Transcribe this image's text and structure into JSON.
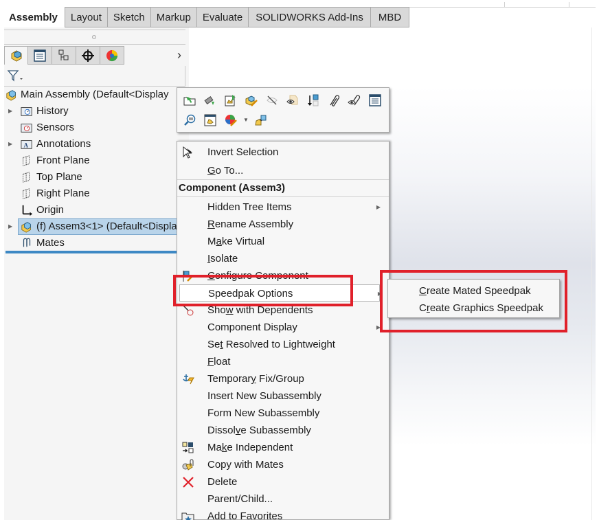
{
  "command_tabs": [
    {
      "label": "Assembly",
      "active": true
    },
    {
      "label": "Layout",
      "active": false
    },
    {
      "label": "Sketch",
      "active": false
    },
    {
      "label": "Markup",
      "active": false
    },
    {
      "label": "Evaluate",
      "active": false
    },
    {
      "label": "SOLIDWORKS Add-Ins",
      "active": false
    },
    {
      "label": "MBD",
      "active": false
    }
  ],
  "panel_tabs": [
    "feature-manager-icon",
    "property-manager-icon",
    "configuration-manager-icon",
    "dimxpert-manager-icon",
    "display-manager-icon"
  ],
  "panel_more": "›",
  "tree": {
    "root": "Main Assembly  (Default<Display",
    "items": [
      {
        "label": "History",
        "icon": "history-folder-icon",
        "expandable": true
      },
      {
        "label": "Sensors",
        "icon": "sensors-folder-icon",
        "expandable": false
      },
      {
        "label": "Annotations",
        "icon": "annotations-folder-icon",
        "expandable": true
      },
      {
        "label": "Front Plane",
        "icon": "plane-icon",
        "expandable": false
      },
      {
        "label": "Top Plane",
        "icon": "plane-icon",
        "expandable": false
      },
      {
        "label": "Right Plane",
        "icon": "plane-icon",
        "expandable": false
      },
      {
        "label": "Origin",
        "icon": "origin-icon",
        "expandable": false
      },
      {
        "label": "(f) Assem3<1> (Default<Displa",
        "icon": "assembly-icon",
        "expandable": true,
        "selected": true
      },
      {
        "label": "Mates",
        "icon": "mates-icon",
        "expandable": false
      }
    ]
  },
  "context_toolbar": {
    "row1": [
      "open-part-icon",
      "edit-part-icon",
      "open-assembly-icon",
      "edit-component-icon",
      "hide-component-icon",
      "change-transparency-icon",
      "view-origin-icon",
      "view-mates-icon",
      "view-mates-dependencies-icon",
      "component-properties-icon"
    ],
    "row2": [
      "zoom-to-selection-icon",
      "component-preview-icon",
      "appearance-icon",
      "dropdown-arrow",
      "smart-mates-icon"
    ]
  },
  "context_menu": {
    "top_items": [
      {
        "label": "Invert Selection",
        "underline": null,
        "icon": "invert-selection-icon"
      },
      {
        "pre": "",
        "u": "G",
        "post": "o To..."
      }
    ],
    "section_header": "Component (Assem3)",
    "items": [
      {
        "pre": "Hidden Tree Items",
        "u": "",
        "post": "",
        "submenu": true,
        "icon": null
      },
      {
        "pre": "",
        "u": "R",
        "post": "ename Assembly",
        "submenu": false,
        "icon": null
      },
      {
        "pre": "M",
        "u": "a",
        "post": "ke Virtual",
        "submenu": false,
        "icon": null
      },
      {
        "pre": "",
        "u": "I",
        "post": "solate",
        "submenu": false,
        "icon": null
      },
      {
        "pre": "",
        "u": "C",
        "post": "onfigure Component",
        "submenu": false,
        "icon": "configure-component-icon"
      },
      {
        "pre": "Speedpak Options",
        "u": "",
        "post": "",
        "submenu": true,
        "icon": null,
        "hover": true
      },
      {
        "pre": "Sho",
        "u": "w",
        "post": " with Dependents",
        "submenu": false,
        "icon": "show-dependents-icon"
      },
      {
        "pre": "Component Display",
        "u": "",
        "post": "",
        "submenu": true,
        "icon": null
      },
      {
        "pre": "Se",
        "u": "t",
        "post": " Resolved to Lightweight",
        "submenu": false,
        "icon": null
      },
      {
        "pre": "",
        "u": "F",
        "post": "loat",
        "submenu": false,
        "icon": null
      },
      {
        "pre": "Temporar",
        "u": "y",
        "post": " Fix/Group",
        "submenu": false,
        "icon": "temporary-fix-icon"
      },
      {
        "pre": "Insert New Subassembly",
        "u": "",
        "post": "",
        "submenu": false,
        "icon": null
      },
      {
        "pre": "Form New Subassembly",
        "u": "",
        "post": "",
        "submenu": false,
        "icon": null
      },
      {
        "pre": "Dissol",
        "u": "v",
        "post": "e Subassembly",
        "submenu": false,
        "icon": null
      },
      {
        "pre": "Ma",
        "u": "k",
        "post": "e Independent",
        "submenu": false,
        "icon": "make-independent-icon"
      },
      {
        "pre": "Copy with Mates",
        "u": "",
        "post": "",
        "submenu": false,
        "icon": "copy-with-mates-icon"
      },
      {
        "pre": "Delete",
        "u": "",
        "post": "",
        "submenu": false,
        "icon": "delete-icon"
      },
      {
        "pre": "Parent/Child...",
        "u": "",
        "post": "",
        "submenu": false,
        "icon": null
      },
      {
        "pre": "Add to Favorites",
        "u": "",
        "post": "",
        "submenu": false,
        "icon": "add-to-favorites-icon"
      }
    ]
  },
  "submenu": {
    "items": [
      {
        "pre": "",
        "u": "C",
        "post": "reate Mated Speedpak"
      },
      {
        "pre": "C",
        "u": "r",
        "post": "eate Graphics Speedpak"
      }
    ]
  },
  "colors": {
    "highlight": "#e0202a",
    "selection": "#b9d4ea",
    "accent_line": "#3d88c4"
  }
}
